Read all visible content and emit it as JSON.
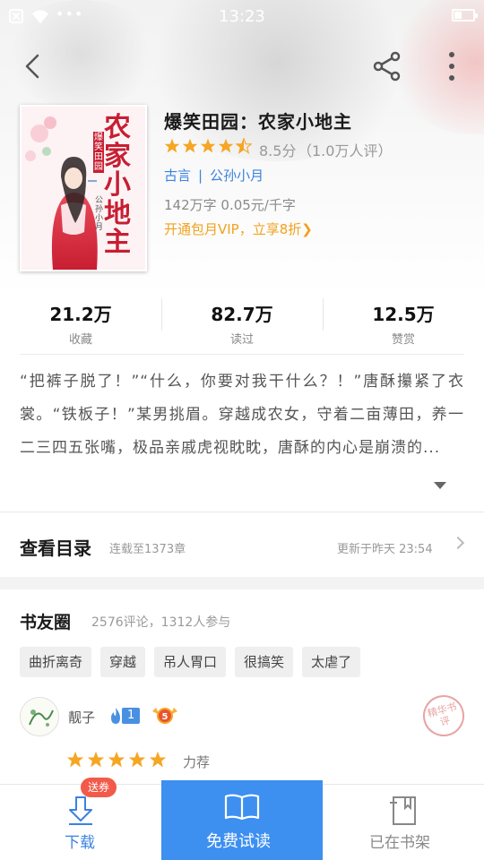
{
  "status_bar": {
    "time": "13:23",
    "dots": "•••"
  },
  "book": {
    "title": "爆笑田园：农家小地主",
    "rating_score": "8.5分",
    "rating_count": "（1.0万人评）",
    "stars_filled": 4.5,
    "category": "古言",
    "author": "公孙小月",
    "word_count": "142万字 0.05元/千字",
    "vip_text": "开通包月VIP，立享8折",
    "vip_chevron": "❯",
    "cover": {
      "title_large": "农家小地主",
      "title_small": "爆笑田园",
      "author": "公孙小月"
    }
  },
  "stats": [
    {
      "value": "21.2万",
      "label": "收藏"
    },
    {
      "value": "82.7万",
      "label": "读过"
    },
    {
      "value": "12.5万",
      "label": "赞赏"
    }
  ],
  "synopsis": "“把裤子脱了！”“什么，你要对我干什么？！”唐酥攥紧了衣裳。“铁板子！”某男挑眉。穿越成农女，守着二亩薄田，养一二三四五张嘴，极品亲戚虎视眈眈，唐酥的内心是崩溃的...",
  "toc": {
    "title": "查看目录",
    "sub": "连载至1373章",
    "update": "更新于昨天 23:54"
  },
  "circle": {
    "title": "书友圈",
    "meta": "2576评论，1312人参与",
    "tags": [
      "曲折离奇",
      "穿越",
      "吊人胃口",
      "很搞笑",
      "太虐了"
    ]
  },
  "comment": {
    "user": "靓子",
    "level": "1",
    "vip_level": "5",
    "stars": 5,
    "tag": "力荐",
    "stamp_text": "精华书评"
  },
  "bottom_bar": {
    "download_label": "下载",
    "download_badge": "送券",
    "read_label": "免费试读",
    "shelf_label": "已在书架"
  },
  "colors": {
    "accent_blue": "#3d8ff0",
    "star_orange": "#f5a623",
    "vip_orange": "#f1a21e",
    "badge_red": "#f25a4a"
  }
}
